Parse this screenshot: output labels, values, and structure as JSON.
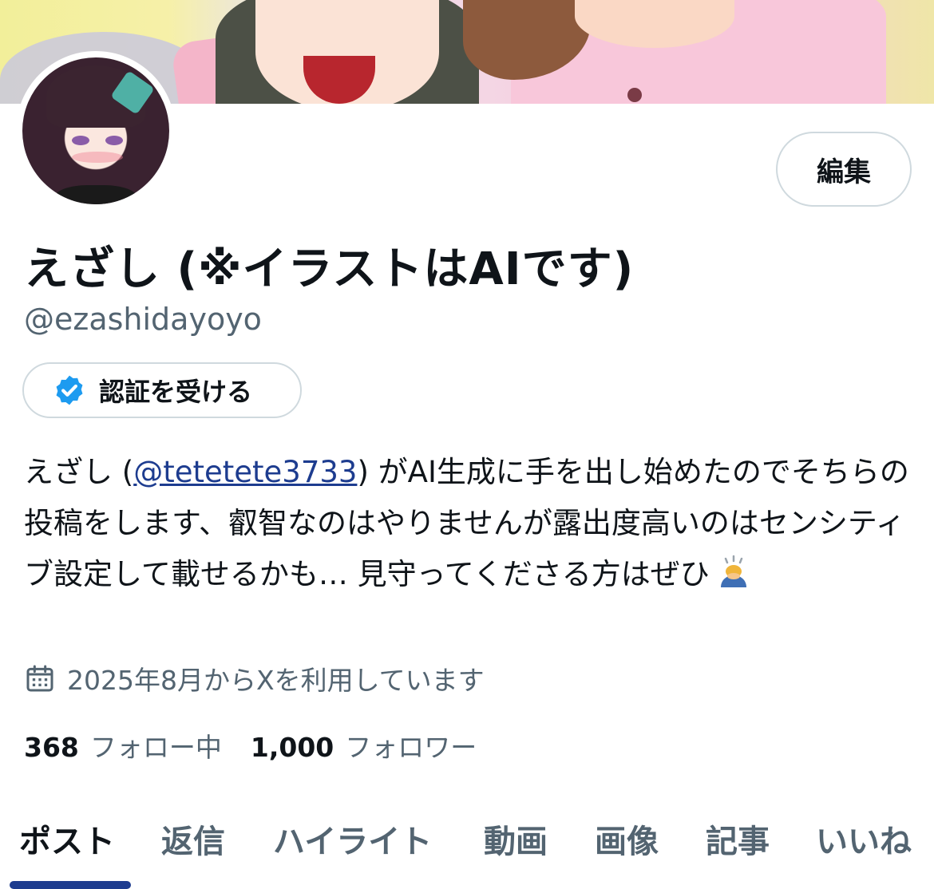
{
  "profile": {
    "display_name": "えざし (※イラストはAIです)",
    "handle": "@ezashidayoyo",
    "edit_label": "編集",
    "verify_label": "認証を受ける",
    "bio": {
      "prefix": "えざし (",
      "mention": "@tetetete3733",
      "text": ") がAI生成に手を出し始めたのでそちらの投稿をします、叡智なのはやりませんが露出度高いのはセンシティブ設定して載せるかも… 見守ってくださる方はぜひ"
    },
    "joined": "2025年8月からXを利用しています",
    "following_count": "368",
    "following_label": "フォロー中",
    "followers_count": "1,000",
    "followers_label": "フォロワー"
  },
  "tabs": [
    {
      "label": "ポスト",
      "active": true
    },
    {
      "label": "返信"
    },
    {
      "label": "ハイライト"
    },
    {
      "label": "動画"
    },
    {
      "label": "画像"
    },
    {
      "label": "記事"
    },
    {
      "label": "いいね"
    }
  ],
  "colors": {
    "accent": "#1d3c8f",
    "verified_badge": "#1d9bf0",
    "muted_text": "#536471"
  },
  "icons": {
    "verified": "verified-badge-icon",
    "calendar": "calendar-icon",
    "emoji": "bowing-person-emoji"
  }
}
